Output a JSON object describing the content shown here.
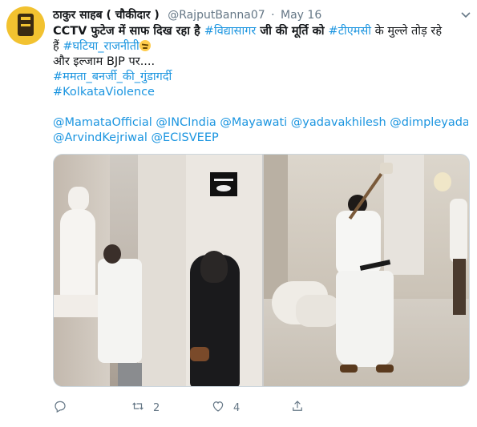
{
  "tweet": {
    "display_name": "ठाकुर साहब ( चौकीदार )",
    "handle": "@RajputBanna07",
    "separator": "·",
    "date": "May 16",
    "body": {
      "line1_lead": "CCTV फुटेज में साफ दिख रहा है ",
      "line1_tag": "#विद्यासागर",
      "line1_mid": " जी की मूर्ति को ",
      "line1_tag2": "#टीएमसी",
      "line1_tail": " के मुल्ले तोड़ रहे",
      "line2_lead": "हैं ",
      "line2_tag": "#घटिया_राजनीती",
      "line3": "और इल्जाम BJP पर....",
      "hashtag_1": "#ममता_बनर्जी_की_गुंडागर्दी",
      "hashtag_2": "#KolkataViolence",
      "mentions_line1": "@MamataOfficial @INCIndia @Mayawati @yadavakhilesh @dimpleyadav",
      "mentions_line2": "@ArvindKejriwal @ECISVEEP"
    },
    "actions": {
      "reply_count": "",
      "retweet_count": "2",
      "like_count": "4"
    }
  },
  "icons": {
    "caret": "chevron-down-icon",
    "reply": "reply-icon",
    "retweet": "retweet-icon",
    "like": "heart-icon",
    "share": "share-icon",
    "emoji": "angry-face-emoji"
  },
  "colors": {
    "link": "#1b95e0",
    "text": "#14171a",
    "muted": "#657786"
  }
}
